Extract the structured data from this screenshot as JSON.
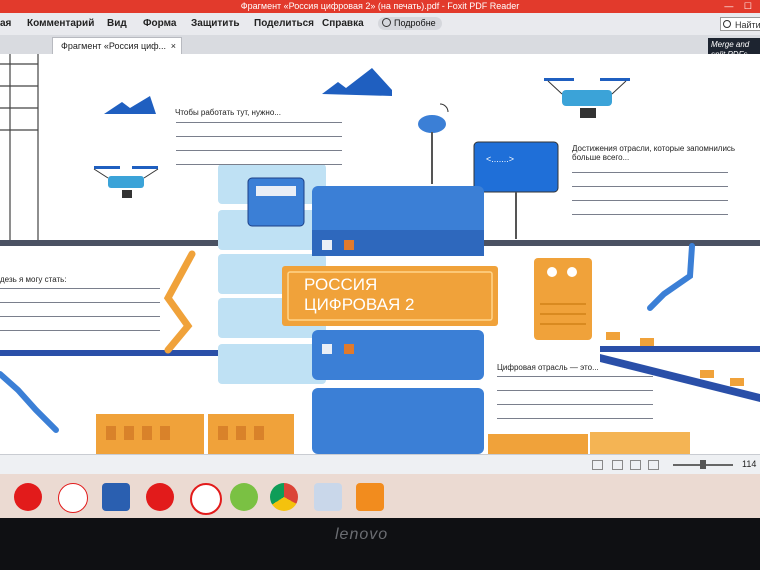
{
  "window": {
    "title": "Фрагмент «Россия цифровая 2» (на печать).pdf - Foxit PDF Reader",
    "controls": [
      "—",
      "☐"
    ]
  },
  "menu": {
    "items": [
      "ая",
      "Комментарий",
      "Вид",
      "Форма",
      "Защитить",
      "Поделиться",
      "Справка"
    ],
    "more_label": "Подробне",
    "search_placeholder": "Найти"
  },
  "tab": {
    "label": "Фрагмент «Россия циф...",
    "close": "×"
  },
  "side_panel": {
    "text": "Merge and split PDFs"
  },
  "document": {
    "heading": "РОССИЯ ЦИФРОВАЯ 2",
    "heading_line1": "РОССИЯ",
    "heading_line2": "ЦИФРОВАЯ 2",
    "prompt_work": "Чтобы работать тут, нужно...",
    "prompt_achievements": "Достижения отрасли, которые запомнились больше всего...",
    "prompt_become": "дезь я могу стать:",
    "prompt_industry": "Цифровая отрасль — это...",
    "code_tag": "<.......>"
  },
  "statusbar": {
    "zoom": "114"
  },
  "taskbar": {
    "apps": [
      "opera-icon",
      "yandex-icon",
      "word-icon",
      "opera-icon",
      "yandex-browser-icon",
      "petal-icon",
      "chrome-icon",
      "explorer-icon",
      "foxit-icon"
    ]
  },
  "bezel": {
    "brand": "lenovo"
  },
  "colors": {
    "titlebar": "#e23a2c",
    "server_blue": "#3b7fd6",
    "orange_panel": "#f0a23a",
    "accent_blue": "#1f5fc0"
  }
}
